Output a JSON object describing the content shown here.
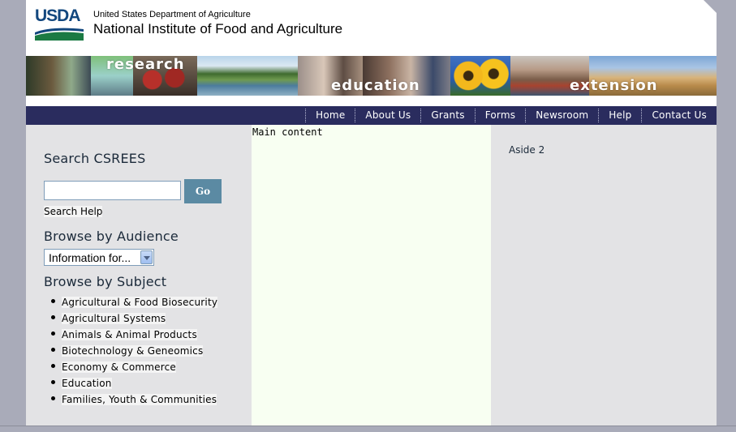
{
  "header": {
    "logo_text": "USDA",
    "department": "United States Department of Agriculture",
    "institute": "National Institute of Food and Agriculture"
  },
  "banner": {
    "words": [
      "research",
      "education",
      "extension"
    ]
  },
  "nav": {
    "items": [
      "Home",
      "About Us",
      "Grants",
      "Forms",
      "Newsroom",
      "Help",
      "Contact Us"
    ]
  },
  "sidebar": {
    "search_heading": "Search CSREES",
    "search_value": "",
    "go_label": "Go",
    "search_help": "Search Help",
    "audience_heading": "Browse by Audience",
    "audience_select": "Information for...",
    "subject_heading": "Browse by Subject",
    "subjects": [
      "Agricultural & Food Biosecurity",
      "Agricultural Systems",
      "Animals & Animal Products",
      "Biotechnology & Geneomics",
      "Economy & Commerce",
      "Education",
      "Families, Youth & Communities"
    ]
  },
  "main": {
    "label": "Main content"
  },
  "aside": {
    "label": "Aside 2"
  },
  "colors": {
    "nav_bg": "#2a2c5e",
    "page_bg": "#a9abb9",
    "main_bg": "#f8fff2",
    "button_bg": "#5b8aa3",
    "brand_blue": "#12477e",
    "brand_green": "#1b7a43"
  }
}
